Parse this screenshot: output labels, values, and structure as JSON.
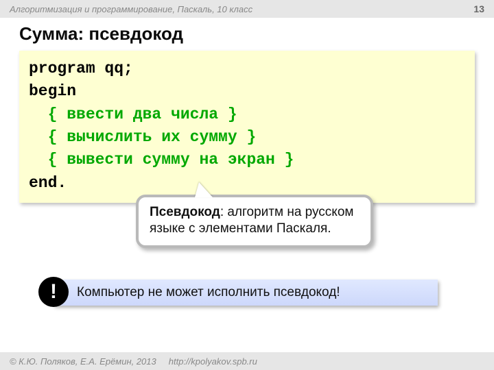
{
  "header": {
    "course_line": "Алгоритмизация и программирование, Паскаль, 10 класс",
    "page_number": "13"
  },
  "title": "Сумма: псевдокод",
  "code": {
    "line1": "program qq;",
    "line2": "begin",
    "line3": "  { ввести два числа }",
    "line4": "  { вычислить их сумму }",
    "line5": "  { вывести сумму на экран }",
    "line6": "end."
  },
  "callout": {
    "term": "Псевдокод",
    "rest": ": алгоритм на русском языке с элементами Паскаля."
  },
  "notice": {
    "badge": "!",
    "text": "Компьютер не может исполнить псевдокод!"
  },
  "footer": {
    "copyright": "© К.Ю. Поляков, Е.А. Ерёмин, 2013",
    "url": "http://kpolyakov.spb.ru"
  }
}
